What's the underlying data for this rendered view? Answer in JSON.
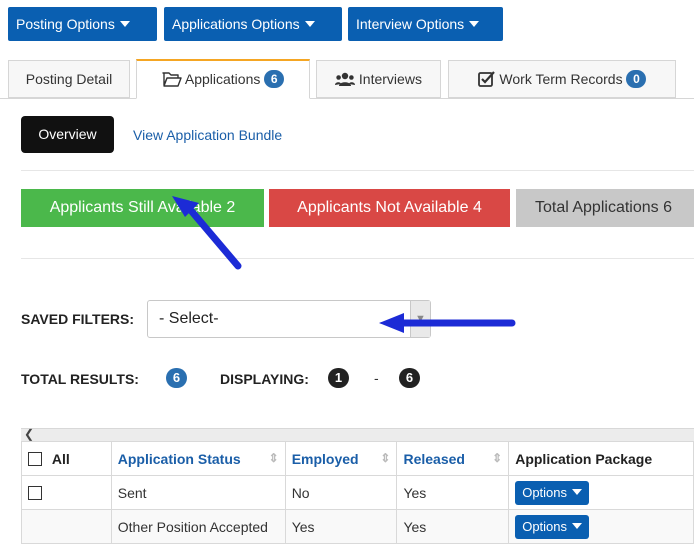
{
  "top_buttons": [
    "Posting Options",
    "Applications Options",
    "Interview Options"
  ],
  "tabs": [
    {
      "label": "Posting Detail"
    },
    {
      "label": "Applications",
      "count": "6"
    },
    {
      "label": "Interviews"
    },
    {
      "label": "Work Term Records",
      "count": "0"
    }
  ],
  "subnav": {
    "overview": "Overview",
    "bundle_link": "View Application Bundle"
  },
  "status_buttons": [
    {
      "label": "Applicants Still Available 2",
      "color": "#4bb84b"
    },
    {
      "label": "Applicants Not Available 4",
      "color": "#d94845"
    },
    {
      "label": "Total Applications 6",
      "color": "#c8c8c8"
    }
  ],
  "filters": {
    "label": "SAVED FILTERS:",
    "selected": "- Select-"
  },
  "results": {
    "total_label": "TOTAL RESULTS:",
    "total": "6",
    "displaying_label": "DISPLAYING:",
    "from": "1",
    "sep": "-",
    "to": "6"
  },
  "table": {
    "all_label": "All",
    "columns": [
      "Application Status",
      "Employed",
      "Released",
      "Application Package"
    ],
    "rows": [
      {
        "status": "Sent",
        "employed": "No",
        "released": "Yes",
        "action": "Options"
      },
      {
        "status": "Other Position Accepted",
        "employed": "Yes",
        "released": "Yes",
        "action": "Options"
      }
    ]
  },
  "colors": {
    "primary": "#0a5fb1",
    "tab_accent": "#f5a623",
    "annotation_arrow": "#1c2bd6"
  }
}
